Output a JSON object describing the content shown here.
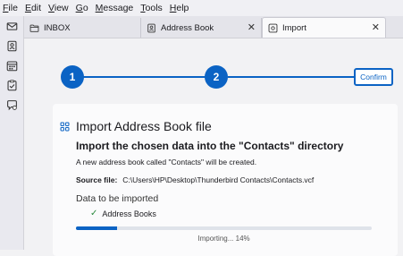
{
  "menu": [
    {
      "accel": "F",
      "rest": "ile"
    },
    {
      "accel": "E",
      "rest": "dit"
    },
    {
      "accel": "V",
      "rest": "iew"
    },
    {
      "accel": "G",
      "rest": "o"
    },
    {
      "accel": "M",
      "rest": "essage"
    },
    {
      "accel": "T",
      "rest": "ools"
    },
    {
      "accel": "H",
      "rest": "elp"
    }
  ],
  "tabs": {
    "inbox": "INBOX",
    "address_book": "Address Book",
    "import": "Import",
    "close_glyph": "✕"
  },
  "stepper": {
    "step1": "1",
    "step2": "2",
    "confirm": "Confirm"
  },
  "card": {
    "title": "Import Address Book file",
    "heading": "Import the chosen data into the \"Contacts\" directory",
    "note": "A new address book called \"Contacts\" will be created.",
    "source_label": "Source file:",
    "source_path": "C:\\Users\\HP\\Desktop\\Thunderbird Contacts\\Contacts.vcf",
    "section_title": "Data to be imported",
    "item": "Address Books",
    "progress_label": "Importing... 14%"
  },
  "progress": {
    "fraction": 0.14
  },
  "icons": {
    "mail": "envelope-icon",
    "address_book": "address-book-icon",
    "calendar": "calendar-icon",
    "tasks": "tasks-icon",
    "chat": "chat-icon"
  },
  "colors": {
    "accent": "#0b63c4",
    "check": "#2b8a3e"
  }
}
